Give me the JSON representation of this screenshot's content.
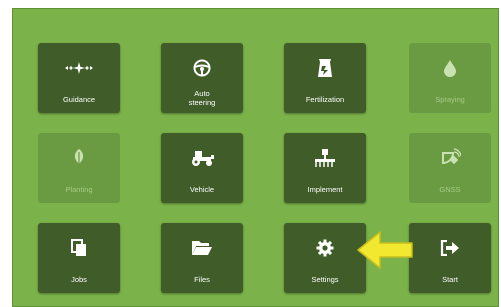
{
  "colors": {
    "background": "#7bb24a",
    "tile": "#3f5c29",
    "tile_disabled": "#6a9a42",
    "arrow": "#f2e830"
  },
  "tiles": [
    {
      "label": "Guidance",
      "icon": "guidance-icon",
      "enabled": true
    },
    {
      "label": "Auto\nsteering",
      "icon": "steering-wheel-icon",
      "enabled": true
    },
    {
      "label": "Fertilization",
      "icon": "fertilizer-bag-icon",
      "enabled": true
    },
    {
      "label": "Spraying",
      "icon": "droplet-icon",
      "enabled": false
    },
    {
      "label": "Planting",
      "icon": "leaf-icon",
      "enabled": false
    },
    {
      "label": "Vehicle",
      "icon": "tractor-icon",
      "enabled": true
    },
    {
      "label": "Implement",
      "icon": "implement-icon",
      "enabled": true
    },
    {
      "label": "GNSS",
      "icon": "satellite-icon",
      "enabled": false
    },
    {
      "label": "Jobs",
      "icon": "copy-icon",
      "enabled": true
    },
    {
      "label": "Files",
      "icon": "folder-open-icon",
      "enabled": true
    },
    {
      "label": "Settings",
      "icon": "gear-icon",
      "enabled": true
    },
    {
      "label": "Start",
      "icon": "sign-out-icon",
      "enabled": true
    }
  ],
  "callout": {
    "icon": "arrow-left-icon"
  }
}
